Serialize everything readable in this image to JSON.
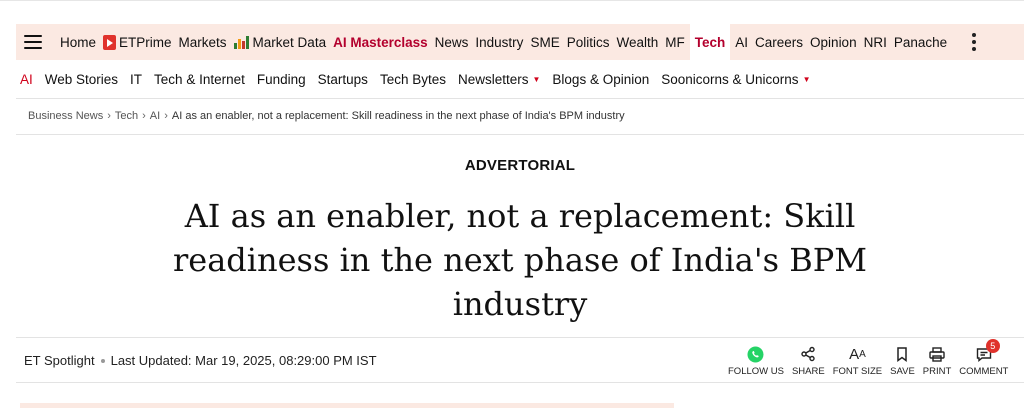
{
  "primary_nav": {
    "items": [
      {
        "label": "Home"
      },
      {
        "label": "ETPrime"
      },
      {
        "label": "Markets"
      },
      {
        "label": "Market Data"
      },
      {
        "label": "AI Masterclass"
      },
      {
        "label": "News"
      },
      {
        "label": "Industry"
      },
      {
        "label": "SME"
      },
      {
        "label": "Politics"
      },
      {
        "label": "Wealth"
      },
      {
        "label": "MF"
      },
      {
        "label": "Tech"
      },
      {
        "label": "AI"
      },
      {
        "label": "Careers"
      },
      {
        "label": "Opinion"
      },
      {
        "label": "NRI"
      },
      {
        "label": "Panache"
      }
    ]
  },
  "secondary_nav": {
    "items": [
      {
        "label": "AI"
      },
      {
        "label": "Web Stories"
      },
      {
        "label": "IT"
      },
      {
        "label": "Tech & Internet"
      },
      {
        "label": "Funding"
      },
      {
        "label": "Startups"
      },
      {
        "label": "Tech Bytes"
      },
      {
        "label": "Newsletters"
      },
      {
        "label": "Blogs & Opinion"
      },
      {
        "label": "Soonicorns & Unicorns"
      }
    ],
    "caret": "▼"
  },
  "breadcrumb": {
    "items": [
      "Business News",
      "Tech",
      "AI"
    ],
    "current": "AI as an enabler, not a replacement: Skill readiness in the next phase of India's BPM industry",
    "separator": "›"
  },
  "article": {
    "section_label": "ADVERTORIAL",
    "headline": "AI as an enabler, not a replacement: Skill readiness in the next phase of India's BPM industry",
    "author": "ET Spotlight",
    "updated": "Last Updated: Mar 19, 2025, 08:29:00 PM IST"
  },
  "actions": {
    "follow": "FOLLOW US",
    "share": "SHARE",
    "font_size": "FONT SIZE",
    "save": "SAVE",
    "print": "PRINT",
    "comment": "COMMENT",
    "comment_count": "5",
    "font_glyph_big": "A",
    "font_glyph_small": "A"
  },
  "colors": {
    "nav_bg": "#fbe9e2",
    "accent_red": "#b3002d",
    "whatsapp_green": "#25d366",
    "badge_red": "#e0322c"
  }
}
